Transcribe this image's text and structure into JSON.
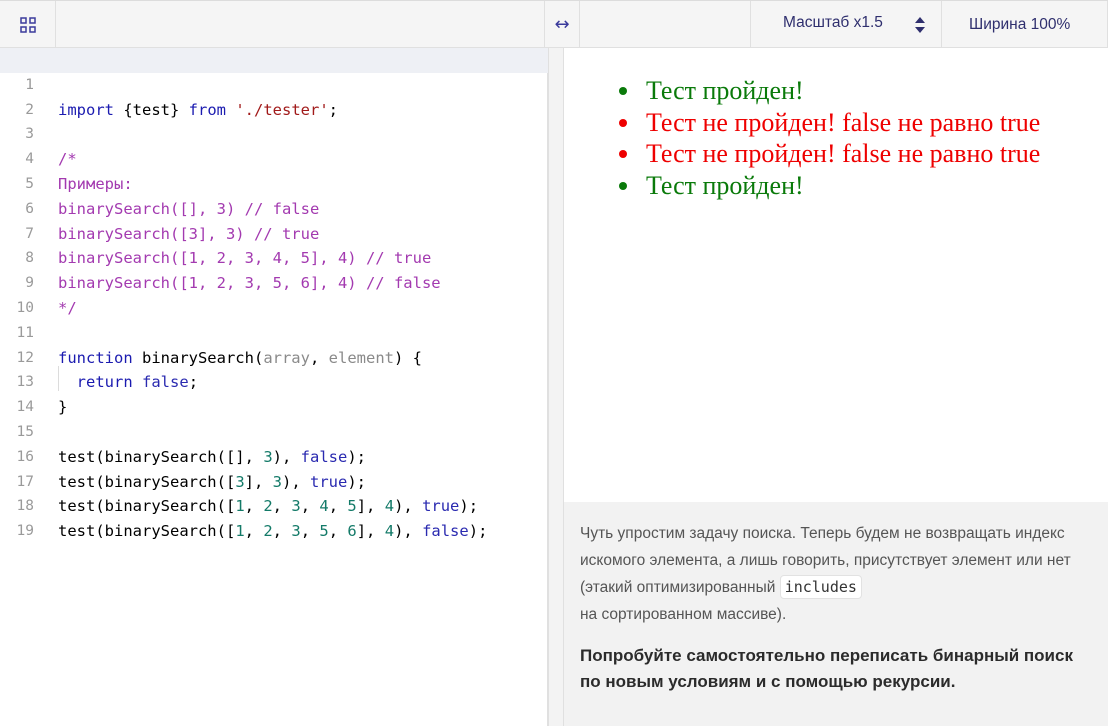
{
  "toolbar": {
    "grid_icon": "grid-icon",
    "resize_icon": "↔",
    "scale_label": "Масштаб x1.5",
    "width_label": "Ширина 100%"
  },
  "editor": {
    "line_numbers": [
      "1",
      "2",
      "3",
      "4",
      "5",
      "6",
      "7",
      "8",
      "9",
      "10",
      "11",
      "12",
      "13",
      "14",
      "15",
      "16",
      "17",
      "18",
      "19"
    ],
    "lines": {
      "l1": {
        "kw1": "import",
        "t1": " {test} ",
        "kw2": "from",
        "t2": " ",
        "str": "'./tester'",
        "t3": ";"
      },
      "l3": "/*",
      "l4": "Примеры:",
      "l5": "binarySearch([], 3) // false",
      "l6": "binarySearch([3], 3) // true",
      "l7": "binarySearch([1, 2, 3, 4, 5], 4) // true",
      "l8": "binarySearch([1, 2, 3, 5, 6], 4) // false",
      "l9": "*/",
      "l11": {
        "kw": "function",
        "name": " binarySearch(",
        "p1": "array",
        "comma": ", ",
        "p2": "element",
        "end": ") {"
      },
      "l12": {
        "indent": "  ",
        "kw": "return",
        "sp": " ",
        "bool": "false",
        "end": ";"
      },
      "l13": "}",
      "l15": {
        "a": "test(binarySearch([], ",
        "n1": "3",
        "b": "), ",
        "bool": "false",
        "c": ");"
      },
      "l16": {
        "a": "test(binarySearch([",
        "n1": "3",
        "b": "], ",
        "n2": "3",
        "c": "), ",
        "bool": "true",
        "d": ");"
      },
      "l17": {
        "a": "test(binarySearch([",
        "n1": "1",
        "c1": ", ",
        "n2": "2",
        "c2": ", ",
        "n3": "3",
        "c3": ", ",
        "n4": "4",
        "c4": ", ",
        "n5": "5",
        "b": "], ",
        "n6": "4",
        "c": "), ",
        "bool": "true",
        "d": ");"
      },
      "l18": {
        "a": "test(binarySearch([",
        "n1": "1",
        "c1": ", ",
        "n2": "2",
        "c2": ", ",
        "n3": "3",
        "c3": ", ",
        "n4": "5",
        "c4": ", ",
        "n5": "6",
        "b": "], ",
        "n6": "4",
        "c": "), ",
        "bool": "false",
        "d": ");"
      }
    }
  },
  "preview": {
    "results": [
      {
        "text": "Тест пройден!",
        "status": "pass"
      },
      {
        "text": "Тест не пройден! false не равно true",
        "status": "fail"
      },
      {
        "text": "Тест не пройден! false не равно true",
        "status": "fail"
      },
      {
        "text": "Тест пройден!",
        "status": "pass"
      }
    ],
    "colors": {
      "pass": "#0a7a0a",
      "fail": "#ee0000"
    }
  },
  "task": {
    "p1_before": "Чуть упростим задачу поиска. Теперь будем не возвращать индекс искомого элемента, а лишь говорить, присутствует элемент или нет (этакий оптимизированный ",
    "p1_code": "includes",
    "p1_after": " на сортированном массиве).",
    "bold": "Попробуйте самостоятельно переписать бинарный поиск по новым условиям и с помощью рекурсии."
  }
}
